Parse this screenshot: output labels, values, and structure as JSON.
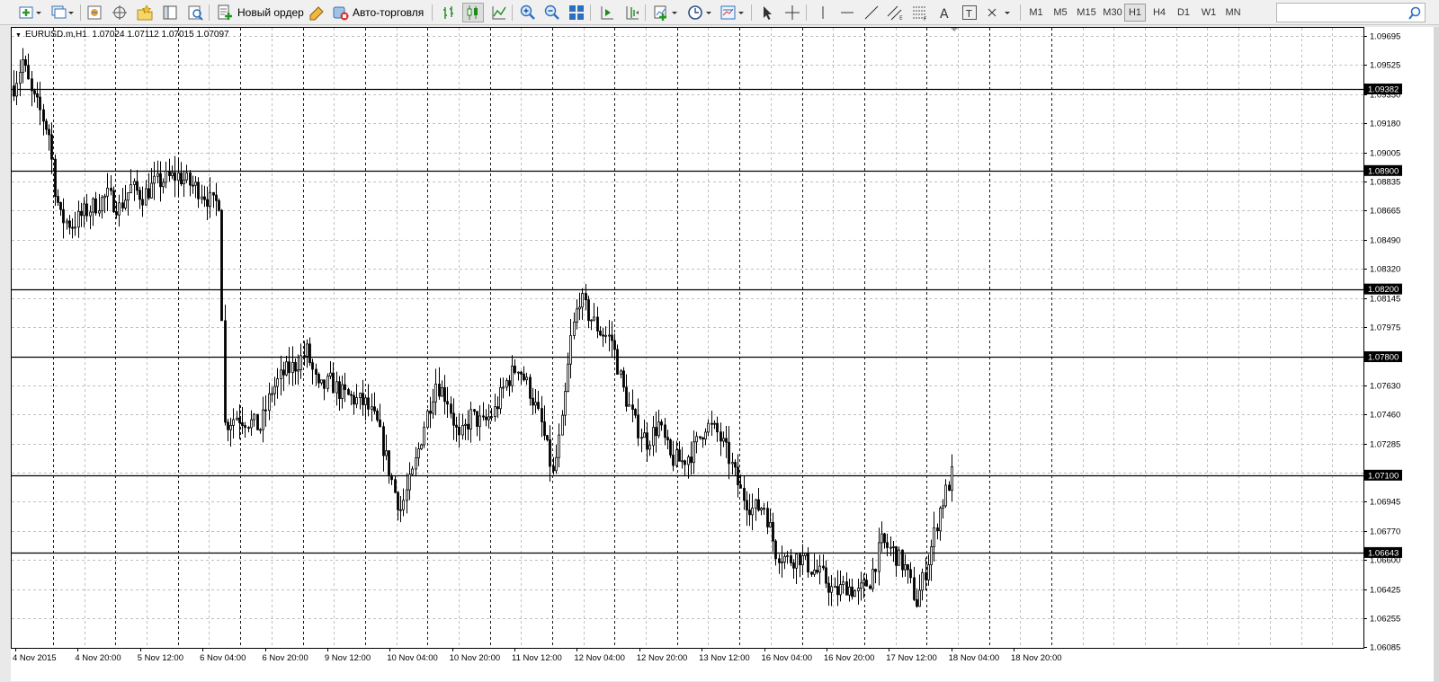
{
  "toolbar": {
    "new_order_label": "Новый ордер",
    "auto_trading_label": "Авто-торговля",
    "timeframes": [
      "M1",
      "M5",
      "M15",
      "M30",
      "H1",
      "H4",
      "D1",
      "W1",
      "MN"
    ],
    "active_timeframe": "H1",
    "search_placeholder": ""
  },
  "chart_data": {
    "type": "candlestick",
    "title": "EURUSD.m,H1",
    "ohlc_header": "1.07024 1.07112 1.07015 1.07097",
    "ylim": [
      1.06085,
      1.0969
    ],
    "y_ticks": [
      "1.09695",
      "1.09525",
      "1.09350",
      "1.09180",
      "1.09005",
      "1.08835",
      "1.08665",
      "1.08490",
      "1.08320",
      "1.08145",
      "1.07975",
      "1.07800",
      "1.07630",
      "1.07460",
      "1.07285",
      "1.07115",
      "1.06945",
      "1.06770",
      "1.06600",
      "1.06425",
      "1.06255",
      "1.06085"
    ],
    "x_tick_labels": [
      "4 Nov 2015",
      "4 Nov 20:00",
      "5 Nov 12:00",
      "6 Nov 04:00",
      "6 Nov 20:00",
      "9 Nov 12:00",
      "10 Nov 04:00",
      "10 Nov 20:00",
      "11 Nov 12:00",
      "12 Nov 04:00",
      "12 Nov 20:00",
      "13 Nov 12:00",
      "16 Nov 04:00",
      "16 Nov 20:00",
      "17 Nov 12:00",
      "18 Nov 04:00",
      "18 Nov 20:00"
    ],
    "horizontal_levels": [
      1.09382,
      1.089,
      1.082,
      1.078,
      1.071,
      1.06643
    ],
    "level_labels": [
      "1.09382",
      "1.08900",
      "1.08200",
      "1.07800",
      "1.07100",
      "1.06643"
    ],
    "grid": true,
    "price_path": [
      [
        0,
        1.094
      ],
      [
        3,
        1.0955
      ],
      [
        6,
        1.0935
      ],
      [
        9,
        1.0925
      ],
      [
        12,
        1.0912
      ],
      [
        14,
        1.088
      ],
      [
        16,
        1.0862
      ],
      [
        20,
        1.0858
      ],
      [
        24,
        1.0865
      ],
      [
        28,
        1.087
      ],
      [
        32,
        1.0875
      ],
      [
        36,
        1.0868
      ],
      [
        40,
        1.088
      ],
      [
        44,
        1.0875
      ],
      [
        48,
        1.0882
      ],
      [
        52,
        1.0885
      ],
      [
        56,
        1.0887
      ],
      [
        60,
        1.0882
      ],
      [
        64,
        1.0878
      ],
      [
        68,
        1.087
      ],
      [
        70,
        1.0872
      ],
      [
        72,
        1.074
      ],
      [
        76,
        1.0745
      ],
      [
        80,
        1.0742
      ],
      [
        84,
        1.0738
      ],
      [
        88,
        1.076
      ],
      [
        92,
        1.077
      ],
      [
        96,
        1.0775
      ],
      [
        100,
        1.0783
      ],
      [
        104,
        1.076
      ],
      [
        108,
        1.0765
      ],
      [
        112,
        1.0758
      ],
      [
        116,
        1.0755
      ],
      [
        120,
        1.0752
      ],
      [
        124,
        1.074
      ],
      [
        127,
        1.072
      ],
      [
        130,
        1.07
      ],
      [
        132,
        1.069
      ],
      [
        136,
        1.071
      ],
      [
        140,
        1.074
      ],
      [
        144,
        1.0765
      ],
      [
        148,
        1.0755
      ],
      [
        152,
        1.073
      ],
      [
        156,
        1.0745
      ],
      [
        160,
        1.074
      ],
      [
        164,
        1.0748
      ],
      [
        168,
        1.0765
      ],
      [
        172,
        1.0775
      ],
      [
        176,
        1.076
      ],
      [
        180,
        1.074
      ],
      [
        184,
        1.071
      ],
      [
        187,
        1.074
      ],
      [
        190,
        1.079
      ],
      [
        193,
        1.0815
      ],
      [
        196,
        1.0805
      ],
      [
        200,
        1.0795
      ],
      [
        204,
        1.079
      ],
      [
        208,
        1.076
      ],
      [
        212,
        1.074
      ],
      [
        216,
        1.073
      ],
      [
        220,
        1.074
      ],
      [
        224,
        1.072
      ],
      [
        228,
        1.0718
      ],
      [
        232,
        1.0725
      ],
      [
        236,
        1.074
      ],
      [
        240,
        1.0735
      ],
      [
        244,
        1.072
      ],
      [
        248,
        1.07
      ],
      [
        252,
        1.069
      ],
      [
        256,
        1.0692
      ],
      [
        260,
        1.0665
      ],
      [
        264,
        1.066
      ],
      [
        268,
        1.0662
      ],
      [
        272,
        1.0655
      ],
      [
        276,
        1.065
      ],
      [
        280,
        1.064
      ],
      [
        284,
        1.0645
      ],
      [
        288,
        1.064
      ],
      [
        292,
        1.0648
      ],
      [
        296,
        1.067
      ],
      [
        300,
        1.0665
      ],
      [
        304,
        1.0655
      ],
      [
        308,
        1.0635
      ],
      [
        312,
        1.066
      ],
      [
        316,
        1.069
      ],
      [
        320,
        1.071
      ]
    ]
  }
}
